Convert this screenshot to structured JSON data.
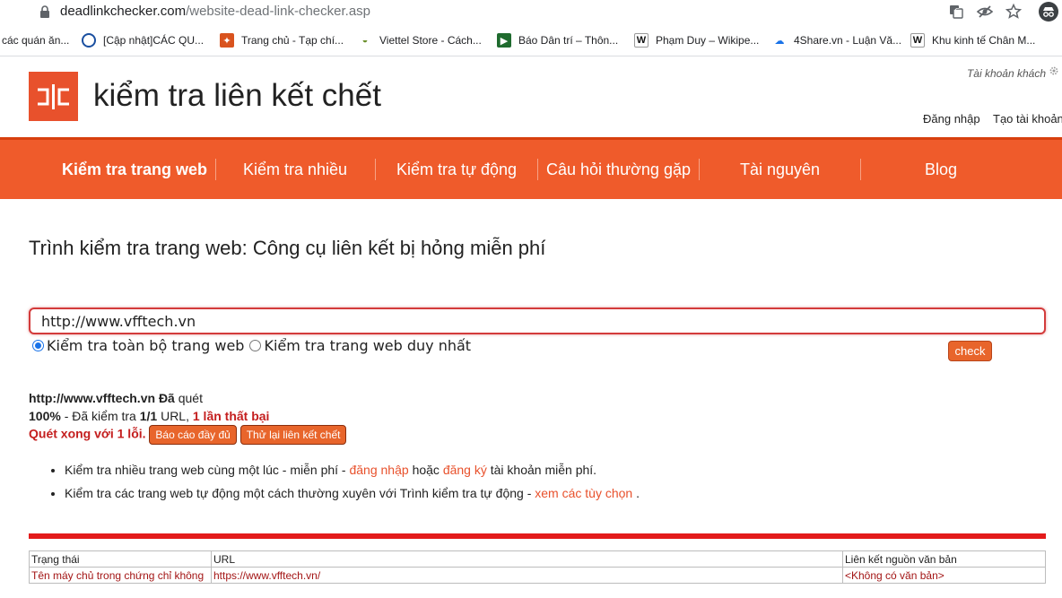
{
  "browser": {
    "url_host": "deadlinkchecker.com",
    "url_path": "/website-dead-link-checker.asp",
    "bookmarks": [
      {
        "label": "các quán ăn...",
        "icon": "none"
      },
      {
        "label": "[Cập nhật]CÁC QU...",
        "icon": "circle-globe-icon"
      },
      {
        "label": "Trang chủ - Tạp chí...",
        "icon": "tapchi-icon"
      },
      {
        "label": "Viettel Store - Cách...",
        "icon": "viettel-icon"
      },
      {
        "label": "Báo Dân trí – Thôn...",
        "icon": "dantri-icon"
      },
      {
        "label": "Phạm Duy – Wikipe...",
        "icon": "wikipedia-icon"
      },
      {
        "label": "4Share.vn - Luận Vă...",
        "icon": "cloud-icon"
      },
      {
        "label": "Khu kinh tế Chân M...",
        "icon": "wikipedia-icon"
      }
    ]
  },
  "header": {
    "brand": "kiểm tra liên kết chết",
    "guest": "Tài khoản khách",
    "login": "Đăng nhập",
    "register": "Tạo tài khoản"
  },
  "nav": [
    {
      "label": "Kiểm tra trang web",
      "active": true
    },
    {
      "label": "Kiểm tra nhiều"
    },
    {
      "label": "Kiểm tra tự động"
    },
    {
      "label": "Câu hỏi thường gặp"
    },
    {
      "label": "Tài nguyên"
    },
    {
      "label": "Blog"
    }
  ],
  "main": {
    "title": "Trình kiểm tra trang web: Công cụ liên kết bị hỏng miễn phí",
    "url_value": "http://www.vfftech.vn",
    "option_whole": "Kiểm tra toàn bộ trang web",
    "option_single": "Kiểm tra trang web duy nhất",
    "check_label": "check"
  },
  "result": {
    "scanned_url": "http://www.vfftech.vn",
    "scanned_word": "Đã",
    "scanned_suffix": "quét",
    "percent": "100%",
    "checked_prefix": "- Đã kiểm tra",
    "checked_count": "1/1",
    "checked_suffix": "URL,",
    "failures": "1 lần thất bại",
    "done_text": "Quét xong với 1 lỗi.",
    "full_report_btn": "Báo cáo đầy đủ",
    "retry_btn": "Thử lại liên kết chết"
  },
  "tips": {
    "tip1_pre": "Kiểm tra nhiều trang web cùng một lúc - miễn phí -",
    "tip1_login": "đăng nhập",
    "tip1_mid": "hoặc",
    "tip1_register": "đăng ký",
    "tip1_post": "tài khoản miễn phí.",
    "tip2_pre": "Kiểm tra các trang web tự động một cách thường xuyên với Trình kiểm tra tự động -",
    "tip2_link": "xem các tùy chọn",
    "tip2_post": "."
  },
  "table": {
    "headers": [
      "Trạng thái",
      "URL",
      "Liên kết nguồn văn bản"
    ],
    "rows": [
      [
        "Tên máy chủ trong chứng chỉ không",
        "https://www.vfftech.vn/",
        "<Không có văn bản>"
      ]
    ]
  },
  "colors": {
    "brand_orange": "#ef5b2b",
    "error_red": "#c41e1e",
    "link_orange": "#e8512c"
  }
}
